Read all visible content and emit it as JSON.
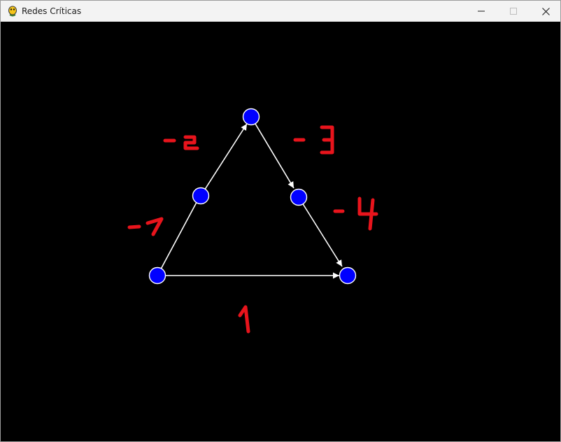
{
  "window": {
    "title": "Redes Críticas",
    "app_icon": "python-snake-icon",
    "controls": [
      "minimize-icon",
      "maximize-icon",
      "close-icon"
    ]
  },
  "canvas": {
    "background": "#000000",
    "node_color": "#0000ff",
    "node_outline": "#ffffff",
    "edge_color": "#ffffff",
    "annotation_color": "#e8141c",
    "edges": [
      {
        "from": "bottom-left",
        "to": "left-middle"
      },
      {
        "from": "left-middle",
        "to": "top"
      },
      {
        "from": "top",
        "to": "right-middle"
      },
      {
        "from": "right-middle",
        "to": "bottom-right"
      },
      {
        "from": "bottom-left",
        "to": "bottom-right"
      }
    ],
    "annotations": [
      "- 1",
      "- 2",
      "- 3",
      "- 4",
      "1"
    ]
  }
}
